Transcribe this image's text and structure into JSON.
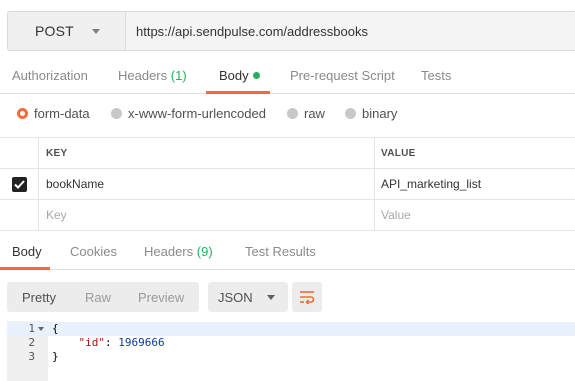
{
  "request": {
    "method": "POST",
    "url": "https://api.sendpulse.com/addressbooks"
  },
  "request_tabs": [
    {
      "label": "Authorization"
    },
    {
      "label": "Headers",
      "count": "(1)"
    },
    {
      "label": "Body"
    },
    {
      "label": "Pre-request Script"
    },
    {
      "label": "Tests"
    }
  ],
  "body_types": [
    {
      "label": "form-data",
      "selected": true
    },
    {
      "label": "x-www-form-urlencoded",
      "selected": false
    },
    {
      "label": "raw",
      "selected": false
    },
    {
      "label": "binary",
      "selected": false
    }
  ],
  "params": {
    "columns": [
      "KEY",
      "VALUE"
    ],
    "rows": [
      {
        "checked": true,
        "key": "bookName",
        "value": "API_marketing_list"
      }
    ],
    "new_row": {
      "key_placeholder": "Key",
      "value_placeholder": "Value"
    }
  },
  "response_tabs": [
    {
      "label": "Body"
    },
    {
      "label": "Cookies"
    },
    {
      "label": "Headers",
      "count": "(9)"
    },
    {
      "label": "Test Results"
    }
  ],
  "response_view": {
    "modes": [
      "Pretty",
      "Raw",
      "Preview"
    ],
    "selected_mode": "Pretty",
    "format": "JSON"
  },
  "response_body": {
    "line_numbers": [
      "1",
      "2",
      "3"
    ],
    "line1": "{",
    "key": "\"id\"",
    "colon": ": ",
    "value": "1969666",
    "line3": "}"
  },
  "colors": {
    "accent": "#f26b3a",
    "success": "#27ae60"
  }
}
